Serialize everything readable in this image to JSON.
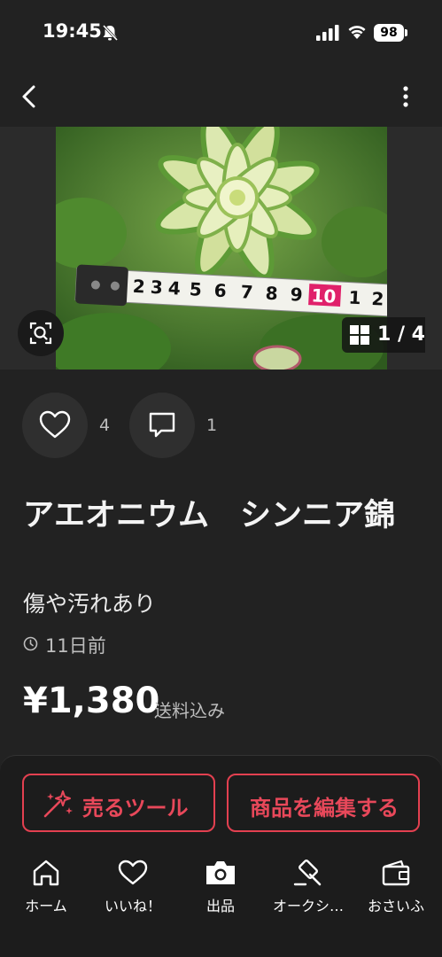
{
  "status_bar": {
    "time": "19:45",
    "battery": "98"
  },
  "gallery": {
    "counter": "1 / 4",
    "tape_numbers": [
      "2",
      "3",
      "4",
      "5",
      "6",
      "7",
      "8",
      "9",
      "10",
      "1",
      "2"
    ]
  },
  "reactions": {
    "likes": "4",
    "comments": "1"
  },
  "item": {
    "title": "アエオニウム　シンニア錦",
    "subtitle": "傷や汚れあり",
    "posted": "11日前",
    "price": "¥1,380",
    "shipping": "送料込み"
  },
  "actions": {
    "sell_tools": "売るツール",
    "edit_item": "商品を編集する"
  },
  "tabs": [
    {
      "label": "ホーム",
      "icon": "home-icon"
    },
    {
      "label": "いいね！",
      "icon": "heart-icon"
    },
    {
      "label": "出品",
      "icon": "camera-icon"
    },
    {
      "label": "オークシ…",
      "icon": "gavel-icon"
    },
    {
      "label": "おさいふ",
      "icon": "wallet-icon"
    }
  ],
  "colors": {
    "accent": "#e8485a",
    "background": "#222222"
  }
}
